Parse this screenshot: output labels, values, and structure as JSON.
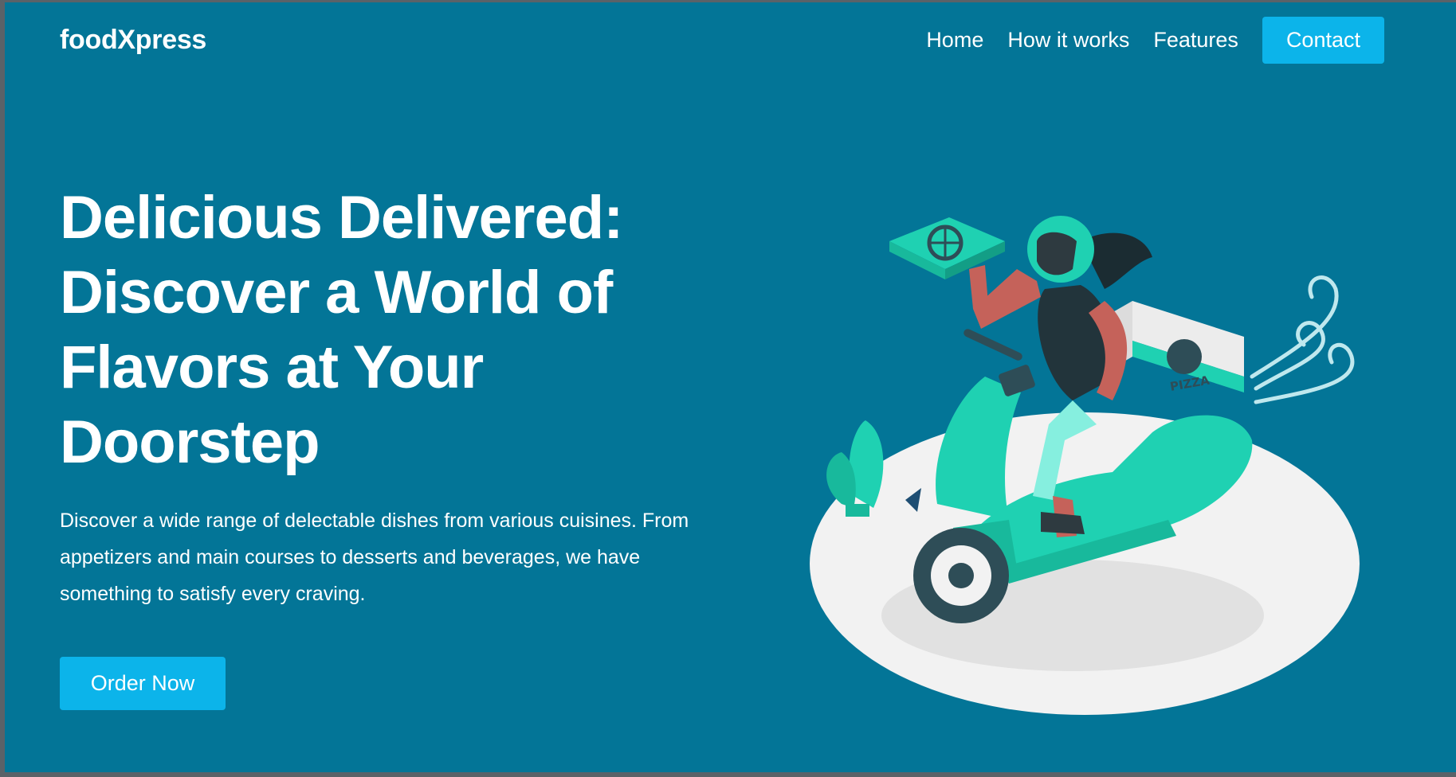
{
  "brand": "foodXpress",
  "nav": {
    "items": [
      {
        "label": "Home"
      },
      {
        "label": "How it works"
      },
      {
        "label": "Features"
      }
    ],
    "contact_label": "Contact"
  },
  "hero": {
    "title": "Delicious Delivered: Discover a World of Flavors at Your Doorstep",
    "description": "Discover a wide range of delectable dishes from various cuisines. From appetizers and main courses to desserts and beverages, we have something to satisfy every craving.",
    "cta_label": "Order Now"
  },
  "illustration": {
    "icon": "delivery-scooter-illustration",
    "box_label": "PIZZA"
  },
  "colors": {
    "background": "#037597",
    "accent": "#0cb4ea",
    "scooter": "#1fd1b2",
    "platform": "#f2f2f2"
  }
}
